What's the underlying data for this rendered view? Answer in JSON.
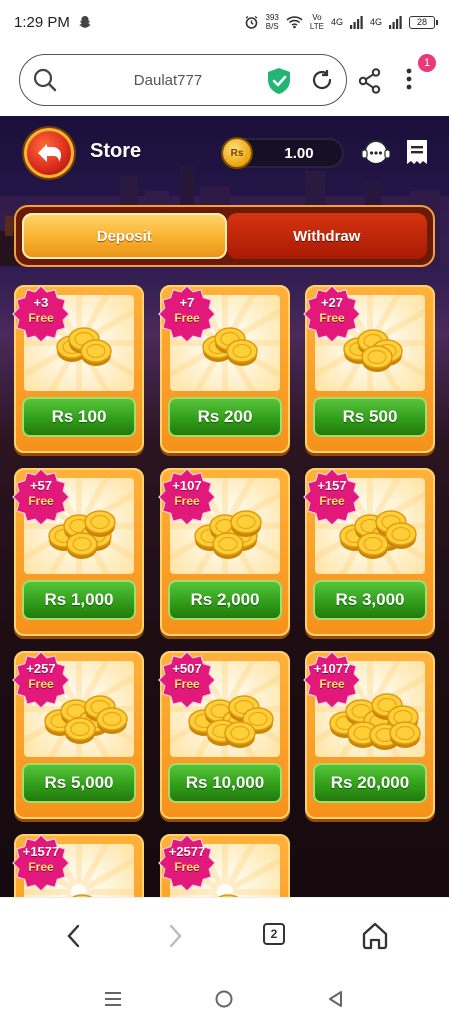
{
  "status_bar": {
    "time": "1:29 PM",
    "speed_value": "393",
    "speed_unit": "B/S",
    "volte_top": "Vo",
    "volte_bottom": "LTE",
    "net1": "4G",
    "net2": "4G",
    "battery": "28"
  },
  "browser": {
    "url_text": "Daulat777",
    "notification_count": "1",
    "tab_count": "2"
  },
  "header": {
    "title": "Store",
    "currency_symbol": "Rs",
    "balance": "1.00"
  },
  "tabs": [
    {
      "label": "Deposit",
      "active": true
    },
    {
      "label": "Withdraw",
      "active": false
    }
  ],
  "packages": [
    {
      "bonus": "+3",
      "free": "Free",
      "price": "Rs 100"
    },
    {
      "bonus": "+7",
      "free": "Free",
      "price": "Rs 200"
    },
    {
      "bonus": "+27",
      "free": "Free",
      "price": "Rs 500"
    },
    {
      "bonus": "+57",
      "free": "Free",
      "price": "Rs 1,000"
    },
    {
      "bonus": "+107",
      "free": "Free",
      "price": "Rs 2,000"
    },
    {
      "bonus": "+157",
      "free": "Free",
      "price": "Rs 3,000"
    },
    {
      "bonus": "+257",
      "free": "Free",
      "price": "Rs 5,000"
    },
    {
      "bonus": "+507",
      "free": "Free",
      "price": "Rs 10,000"
    },
    {
      "bonus": "+1077",
      "free": "Free",
      "price": "Rs 20,000"
    },
    {
      "bonus": "+1577",
      "free": "Free",
      "price": ""
    },
    {
      "bonus": "+2577",
      "free": "Free",
      "price": ""
    }
  ],
  "colors": {
    "accent_green": "#2f9a18",
    "accent_orange": "#f6921b",
    "badge_pink": "#e2197a",
    "tab_active": "#f8b22c",
    "tab_inactive": "#a81a05"
  }
}
